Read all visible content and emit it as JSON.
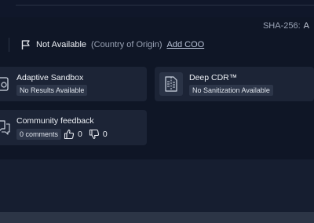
{
  "header": {
    "sha_label": "SHA-256:",
    "sha_value": "A"
  },
  "coo": {
    "status": "Not Available",
    "hint": "(Country of Origin)",
    "link": "Add COO"
  },
  "cards": {
    "sandbox": {
      "title": "Adaptive Sandbox",
      "status": "No Results Available"
    },
    "cdr": {
      "title": "Deep CDR™",
      "status": "No Sanitization Available"
    },
    "feedback": {
      "title": "Community feedback",
      "comments": "0 comments",
      "upvotes": "0",
      "downvotes": "0"
    }
  },
  "icons": [
    "flag-icon",
    "sandbox-icon",
    "document-icon",
    "chat-icon",
    "thumbs-up-icon",
    "thumbs-down-icon"
  ]
}
